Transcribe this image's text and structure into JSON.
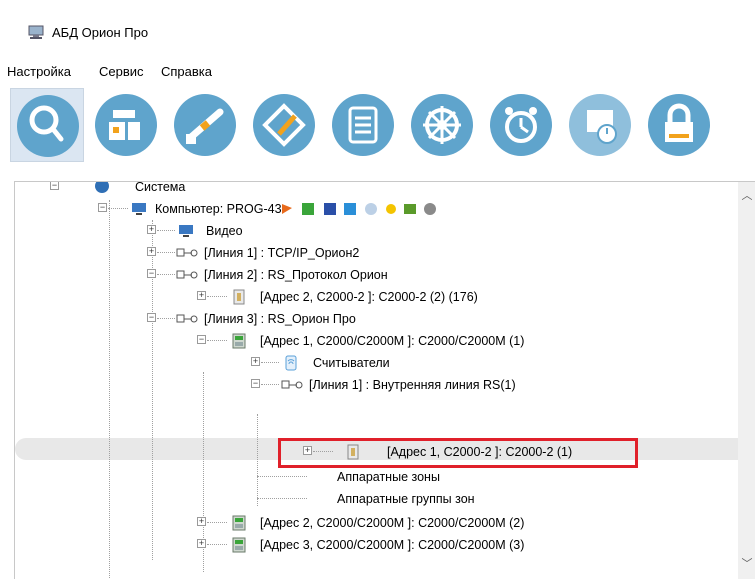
{
  "window": {
    "title": "АБД Орион Про"
  },
  "menu": {
    "items": [
      "Настройка",
      "Сервис",
      "Справка"
    ]
  },
  "toolbar": {
    "buttons": [
      "search-icon",
      "devices-icon",
      "barrier-icon",
      "plan-edit-icon",
      "list-icon",
      "wheel-icon",
      "alarm-clock-icon",
      "schedule-icon",
      "lock-icon"
    ]
  },
  "tree": {
    "system": "Система",
    "computer": "Компьютер: PROG-43",
    "video": "Видео",
    "line1": "[Линия 1] : TCP/IP_Орион2",
    "line2": "[Линия 2] : RS_Протокол Орион",
    "line2_addr2": "[Адрес 2, С2000-2 ]: С2000-2 (2)  (176)",
    "line3": "[Линия 3] : RS_Орион Про",
    "line3_addr1": "[Адрес 1, С2000/С2000М ]: С2000/С2000М (1)",
    "readers": "Считыватели",
    "internal_line": "[Линия 1] : Внутренняя линия RS(1)",
    "selected_device": "[Адрес 1, С2000-2 ]: С2000-2 (1)",
    "hw_zones": "Аппаратные зоны",
    "hw_zone_groups": "Аппаратные группы зон",
    "line3_addr2": "[Адрес 2, С2000/С2000М ]: С2000/С2000М (2)",
    "line3_addr3": "[Адрес 3, С2000/С2000М ]: С2000/С2000М (3)"
  },
  "colors": {
    "highlight_border": "#e0202a",
    "toolbar_circle": "#5fa4cc"
  }
}
